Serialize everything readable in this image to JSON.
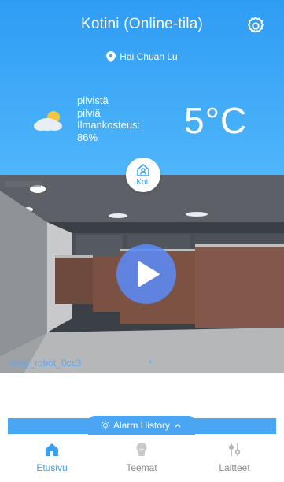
{
  "header": {
    "title": "Kotini (Online-tila)",
    "location": "Hai Chuan Lu",
    "weather": {
      "line1": "pilvistä",
      "line2": "pilviä",
      "line3": "Ilmankosteus:",
      "line4": "86%"
    },
    "temperature": "5°C"
  },
  "home_badge": {
    "label": "Koti"
  },
  "camera": {
    "device_name": "xmjp_robot_0cc3"
  },
  "alarm_history": {
    "label": "Alarm History"
  },
  "tabs": [
    {
      "label": "Etusivu",
      "active": true
    },
    {
      "label": "Teemat",
      "active": false
    },
    {
      "label": "Laitteet",
      "active": false
    }
  ],
  "colors": {
    "accent": "#3aa0f2",
    "header_top": "#2f9cf4",
    "header_bottom": "#4fb6fb",
    "play_button": "#5a8cfa"
  }
}
